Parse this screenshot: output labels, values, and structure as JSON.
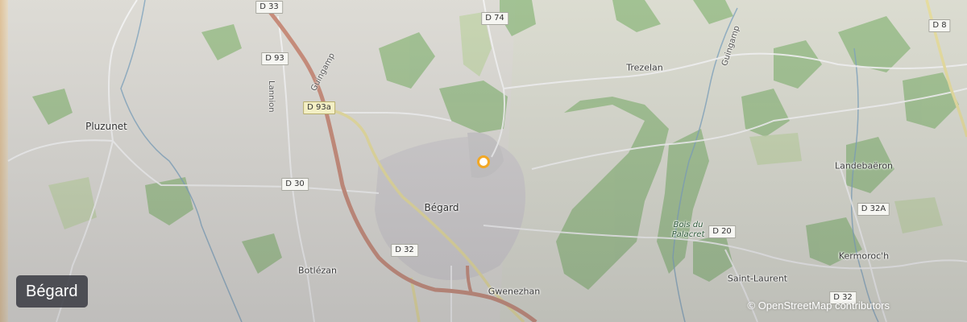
{
  "map": {
    "title": "Bégard",
    "attribution": "© OpenStreetMap contributors",
    "marker_color": "#f2a825",
    "places": [
      {
        "name": "Pluzunet",
        "kind": "town"
      },
      {
        "name": "Bégard",
        "kind": "town"
      },
      {
        "name": "Trezelan",
        "kind": "village"
      },
      {
        "name": "Botlézan",
        "kind": "village"
      },
      {
        "name": "Gwenezhan",
        "kind": "village"
      },
      {
        "name": "Saint-Laurent",
        "kind": "village"
      },
      {
        "name": "Landebaëron",
        "kind": "village"
      },
      {
        "name": "Kermoroc'h",
        "kind": "village"
      },
      {
        "name": "Bois du Palacret",
        "kind": "forest"
      }
    ],
    "road_labels": [
      "Lannion",
      "Guingamp",
      "Guingamp"
    ],
    "road_shields": [
      "D 33",
      "D 74",
      "D 8",
      "D 93",
      "D 93a",
      "D 30",
      "D 32",
      "D 20",
      "D 32A",
      "D 32"
    ]
  }
}
